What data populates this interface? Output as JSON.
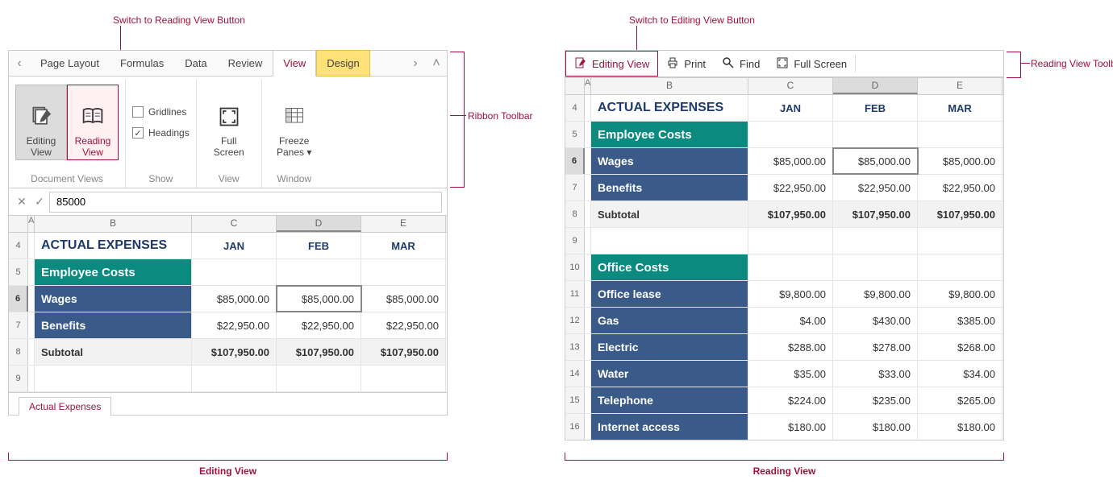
{
  "annotations": {
    "switch_reading": "Switch to Reading View Button",
    "switch_editing": "Switch to Editing View Button",
    "ribbon_toolbar": "Ribbon Toolbar",
    "reading_toolbar": "Reading View Toolbar",
    "editing_view_caption": "Editing View",
    "reading_view_caption": "Reading View"
  },
  "ribbon": {
    "tabs": {
      "page_layout": "Page Layout",
      "formulas": "Formulas",
      "data": "Data",
      "review": "Review",
      "view": "View",
      "design": "Design"
    },
    "groups": {
      "document_views": "Document Views",
      "show": "Show",
      "view": "View",
      "window": "Window"
    },
    "buttons": {
      "editing_view": "Editing\nView",
      "reading_view": "Reading\nView",
      "gridlines": "Gridlines",
      "headings": "Headings",
      "full_screen": "Full\nScreen",
      "freeze_panes": "Freeze\nPanes ▾"
    }
  },
  "formula_bar": {
    "value": "85000"
  },
  "reading_toolbar": {
    "editing_view": "Editing View",
    "print": "Print",
    "find": "Find",
    "full_screen": "Full Screen"
  },
  "grid": {
    "cols": {
      "A": "A",
      "B": "B",
      "C": "C",
      "D": "D",
      "E": "E"
    },
    "title": "ACTUAL EXPENSES",
    "months": {
      "jan": "JAN",
      "feb": "FEB",
      "mar": "MAR"
    },
    "section1": "Employee Costs",
    "section2": "Office Costs",
    "rows": {
      "wages": {
        "label": "Wages",
        "jan": "$85,000.00",
        "feb": "$85,000.00",
        "mar": "$85,000.00"
      },
      "benefits": {
        "label": "Benefits",
        "jan": "$22,950.00",
        "feb": "$22,950.00",
        "mar": "$22,950.00"
      },
      "subtotal": {
        "label": "Subtotal",
        "jan": "$107,950.00",
        "feb": "$107,950.00",
        "mar": "$107,950.00"
      },
      "office_lease": {
        "label": "Office lease",
        "jan": "$9,800.00",
        "feb": "$9,800.00",
        "mar": "$9,800.00"
      },
      "gas": {
        "label": "Gas",
        "jan": "$4.00",
        "feb": "$430.00",
        "mar": "$385.00"
      },
      "electric": {
        "label": "Electric",
        "jan": "$288.00",
        "feb": "$278.00",
        "mar": "$268.00"
      },
      "water": {
        "label": "Water",
        "jan": "$35.00",
        "feb": "$33.00",
        "mar": "$34.00"
      },
      "telephone": {
        "label": "Telephone",
        "jan": "$224.00",
        "feb": "$235.00",
        "mar": "$265.00"
      },
      "internet": {
        "label": "Internet access",
        "jan": "$180.00",
        "feb": "$180.00",
        "mar": "$180.00"
      }
    },
    "rownums": {
      "l": {
        "r4": "4",
        "r5": "5",
        "r6": "6",
        "r7": "7",
        "r8": "8",
        "r9": "9"
      },
      "r": {
        "r4": "4",
        "r5": "5",
        "r6": "6",
        "r7": "7",
        "r8": "8",
        "r9": "9",
        "r10": "10",
        "r11": "11",
        "r12": "12",
        "r13": "13",
        "r14": "14",
        "r15": "15",
        "r16": "16"
      }
    }
  },
  "sheet_tab": "Actual Expenses",
  "colwidths": {
    "B": 195,
    "C": 105,
    "D": 105,
    "E": 105
  }
}
